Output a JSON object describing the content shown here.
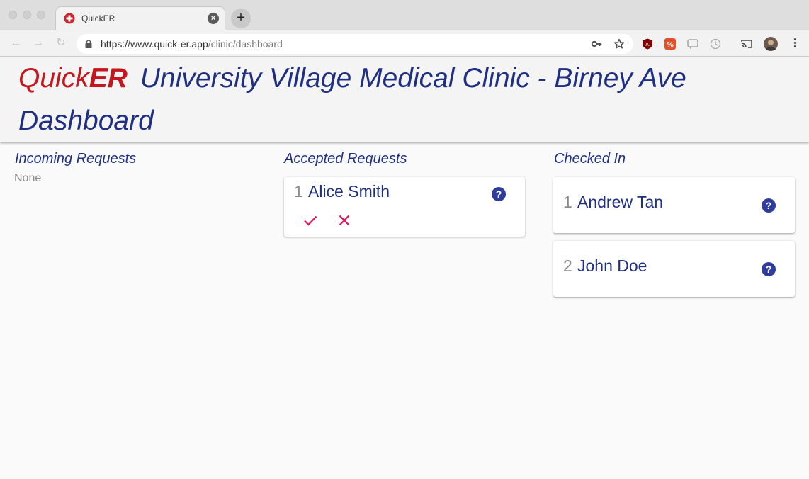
{
  "browser": {
    "tab_title": "QuickER",
    "url_domain": "https://www.quick-er.app",
    "url_path": "/clinic/dashboard",
    "new_tab_label": "+",
    "close_tab_label": "×"
  },
  "header": {
    "brand_quick": "Quick",
    "brand_er": "ER",
    "clinic_name": "University Village Medical Clinic - Birney Ave",
    "page_title": "Dashboard"
  },
  "columns": {
    "incoming": {
      "title": "Incoming Requests",
      "empty_text": "None"
    },
    "accepted": {
      "title": "Accepted Requests",
      "items": [
        {
          "number": "1",
          "name": "Alice Smith"
        }
      ]
    },
    "checked_in": {
      "title": "Checked In",
      "items": [
        {
          "number": "1",
          "name": "Andrew Tan"
        },
        {
          "number": "2",
          "name": "John Doe"
        }
      ]
    }
  },
  "icons": {
    "help": "?",
    "accept": "check-icon",
    "reject": "close-icon"
  },
  "colors": {
    "brand_red": "#c4161c",
    "primary_blue": "#1f3083",
    "help_blue": "#2f3c9c",
    "action_pink": "#e0115f"
  }
}
